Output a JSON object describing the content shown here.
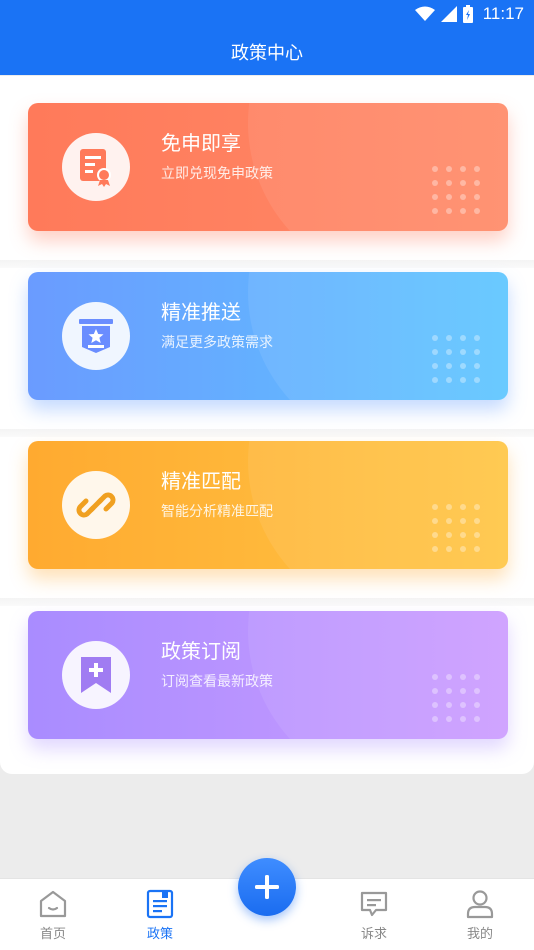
{
  "status_bar": {
    "time": "11:17"
  },
  "header": {
    "title": "政策中心"
  },
  "cards": [
    {
      "title": "免申即享",
      "subtitle": "立即兑现免申政策",
      "icon": "certificate-icon",
      "color": "#ff7a5a"
    },
    {
      "title": "精准推送",
      "subtitle": "满足更多政策需求",
      "icon": "star-badge-icon",
      "color": "#6a9bff"
    },
    {
      "title": "精准匹配",
      "subtitle": "智能分析精准匹配",
      "icon": "link-icon",
      "color": "#ffaa30"
    },
    {
      "title": "政策订阅",
      "subtitle": "订阅查看最新政策",
      "icon": "bookmark-add-icon",
      "color": "#a98cff"
    }
  ],
  "tabbar": {
    "items": [
      {
        "label": "首页",
        "icon": "home-icon",
        "active": false
      },
      {
        "label": "政策",
        "icon": "document-icon",
        "active": true
      },
      {
        "label": "诉求",
        "icon": "message-icon",
        "active": false
      },
      {
        "label": "我的",
        "icon": "user-icon",
        "active": false
      }
    ],
    "fab_icon": "plus-icon"
  },
  "colors": {
    "primary": "#1a73f5",
    "inactive": "#888888"
  }
}
